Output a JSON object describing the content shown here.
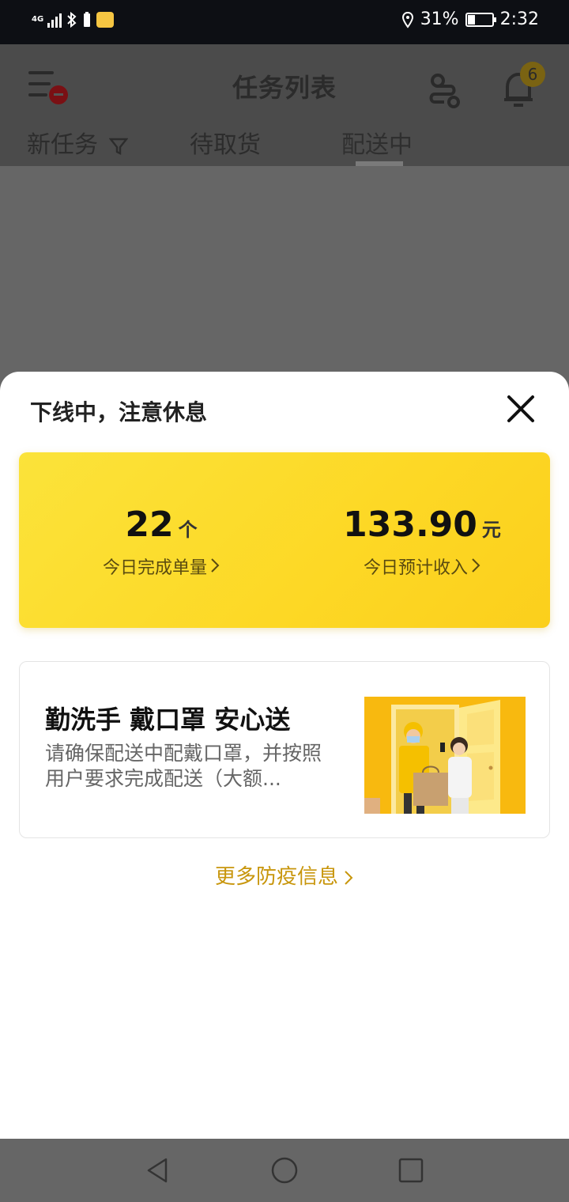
{
  "status_bar": {
    "network": "4G",
    "battery": "31%",
    "battery_level": 0.31,
    "time": "2:32"
  },
  "header": {
    "title": "任务列表",
    "notification_count": "6",
    "tabs": [
      {
        "label": "新任务",
        "active": false
      },
      {
        "label": "待取货",
        "active": false
      },
      {
        "label": "配送中",
        "active": true
      }
    ]
  },
  "sheet": {
    "title": "下线中，注意休息",
    "stats": {
      "orders": {
        "value": "22",
        "unit": "个",
        "label": "今日完成单量"
      },
      "income": {
        "value": "133.90",
        "unit": "元",
        "label": "今日预计收入"
      }
    },
    "info_card": {
      "title": "勤洗手 戴口罩 安心送",
      "description": "请确保配送中配戴口罩，并按照用户要求完成配送（大额..."
    },
    "more_link": "更多防疫信息"
  },
  "colors": {
    "accent_yellow": "#fdd825",
    "link_gold": "#c8960c",
    "overlay": "#666666"
  },
  "icons": [
    "menu-icon",
    "route-icon",
    "bell-icon",
    "filter-icon",
    "close-icon",
    "chevron-right-icon",
    "back-icon",
    "home-icon",
    "recents-icon"
  ]
}
